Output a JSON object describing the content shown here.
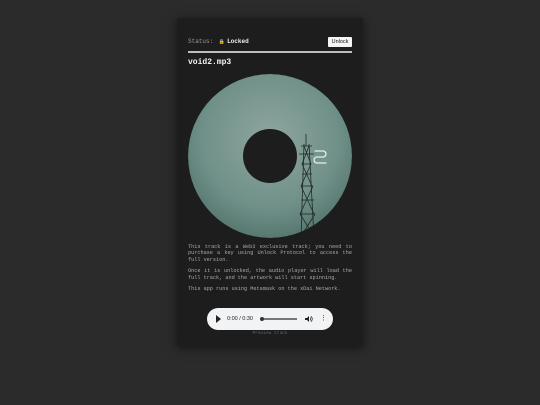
{
  "status": {
    "label": "Status:",
    "value": "Locked",
    "lock_icon": "lock-icon"
  },
  "unlock_button": {
    "label": "Unlock"
  },
  "track": {
    "title": "void2.mp3",
    "progress_fraction": 1.0
  },
  "artwork": {
    "logo_icon": "unlock-protocol-logo-icon",
    "tint": "#6f9088"
  },
  "description": {
    "p1": "This track is a Web3 exclusive track; you need to purchase a key using Unlock Protocol to access the full version.",
    "p2": "Once it is unlocked, the audio player will load the full track, and the artwork will start spinning.",
    "p3": "This app runs using Metamask on the xDai Network."
  },
  "player": {
    "time": "0:00 / 0:30",
    "play_icon": "play-icon",
    "volume_icon": "volume-icon",
    "menu_icon": "more-vert-icon"
  },
  "caption": "Preview track"
}
